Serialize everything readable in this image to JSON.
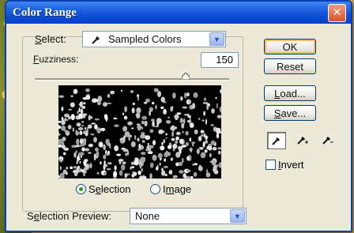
{
  "window": {
    "title": "Color Range",
    "close_glyph": "✕"
  },
  "select": {
    "label_u": "S",
    "label_rest": "elect:",
    "value": "Sampled Colors"
  },
  "fuzziness": {
    "label_u": "F",
    "label_rest": "uzziness:",
    "value": "150",
    "level": 0.78
  },
  "radios": {
    "selection": {
      "pre": "S",
      "u": "e",
      "post": "lection",
      "selected": true
    },
    "image": {
      "pre": "I",
      "u": "m",
      "post": "age",
      "selected": false
    }
  },
  "selection_preview": {
    "label_pre": "S",
    "label_u": "e",
    "label_post": "lection Preview:",
    "value": "None"
  },
  "buttons": {
    "ok": "OK",
    "reset": "Reset",
    "load": {
      "u": "L",
      "rest": "oad..."
    },
    "save": {
      "u": "S",
      "rest": "ave..."
    }
  },
  "invert": {
    "u": "I",
    "rest": "nvert",
    "checked": false
  },
  "colors": {
    "title_bar": "#0a43c3",
    "dialog_bg": "#ece9d8",
    "accent": "#f0b860"
  }
}
